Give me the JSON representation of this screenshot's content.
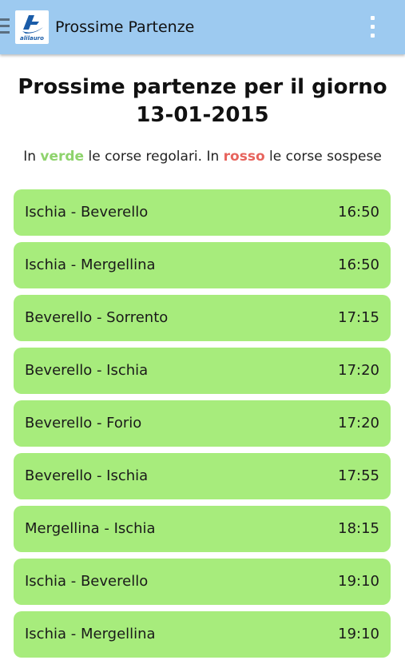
{
  "app_bar": {
    "title": "Prossime Partenze",
    "logo_text": "alilauro",
    "logo_color": "#1a5ca8",
    "bar_color": "#9dcaf0"
  },
  "heading": {
    "line1": "Prossime partenze per il giorno",
    "line2": "13-01-2015"
  },
  "legend": {
    "part1": "In ",
    "green_word": "verde",
    "part2": " le corse regolari. In ",
    "red_word": "rosso",
    "part3": " le corse sospese",
    "green_color": "#8ed36c",
    "red_color": "#e7645d"
  },
  "departures": [
    {
      "route": "Ischia - Beverello",
      "time": "16:50",
      "status": "regolare"
    },
    {
      "route": "Ischia - Mergellina",
      "time": "16:50",
      "status": "regolare"
    },
    {
      "route": "Beverello - Sorrento",
      "time": "17:15",
      "status": "regolare"
    },
    {
      "route": "Beverello - Ischia",
      "time": "17:20",
      "status": "regolare"
    },
    {
      "route": "Beverello - Forio",
      "time": "17:20",
      "status": "regolare"
    },
    {
      "route": "Beverello - Ischia",
      "time": "17:55",
      "status": "regolare"
    },
    {
      "route": "Mergellina - Ischia",
      "time": "18:15",
      "status": "regolare"
    },
    {
      "route": "Ischia - Beverello",
      "time": "19:10",
      "status": "regolare"
    },
    {
      "route": "Ischia - Mergellina",
      "time": "19:10",
      "status": "regolare"
    }
  ],
  "icons": {
    "drawer": "menu-icon",
    "overflow": "more-vert-icon"
  }
}
